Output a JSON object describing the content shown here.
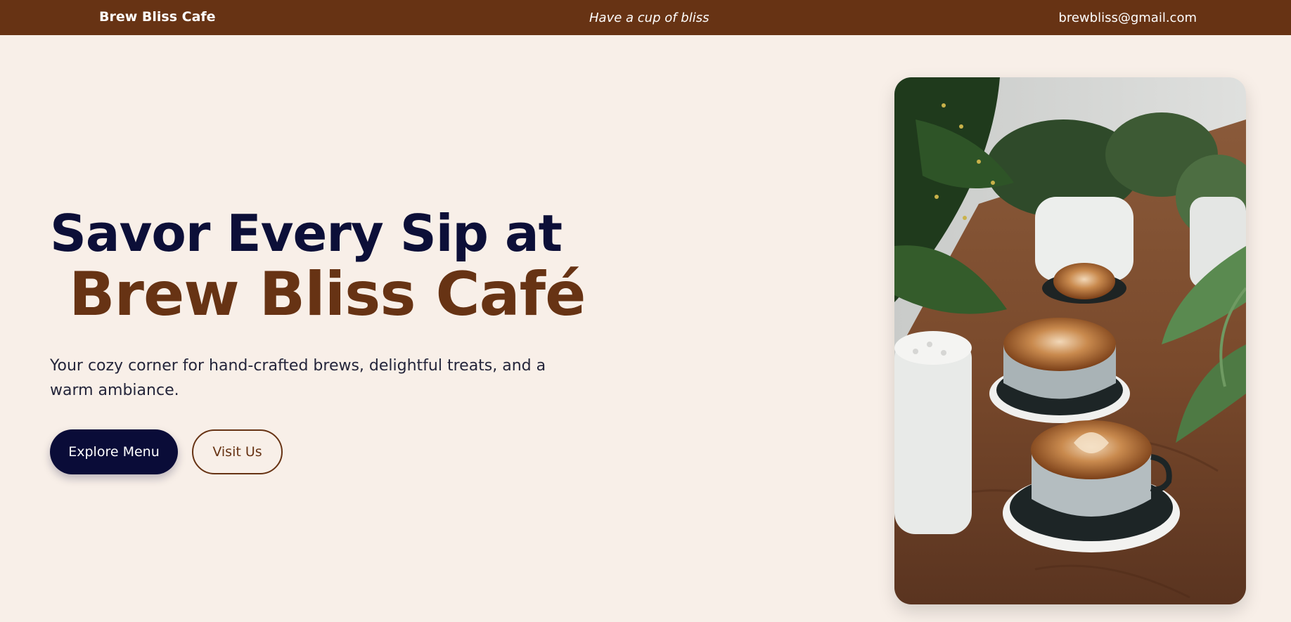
{
  "header": {
    "brand": "Brew Bliss Cafe",
    "tagline": "Have a cup of bliss",
    "email": "brewbliss@gmail.com"
  },
  "hero": {
    "title_line1": "Savor Every Sip at",
    "title_line2": "Brew Bliss Café",
    "description": "Your cozy corner for hand-crafted brews, delightful treats, and a warm ambiance.",
    "primary_button": "Explore Menu",
    "secondary_button": "Visit Us"
  },
  "colors": {
    "header_bg": "#673314",
    "page_bg": "#f8efe8",
    "title_navy": "#0c0f38",
    "accent_brown": "#673314",
    "button_navy": "#0a0c38"
  }
}
